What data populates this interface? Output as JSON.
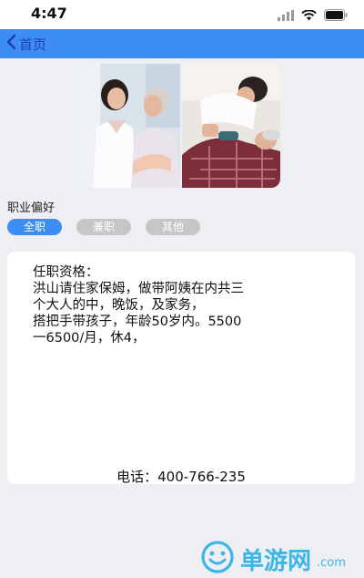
{
  "status_bar": {
    "time": "4:47",
    "icons": [
      "signal-icon",
      "wifi-icon",
      "battery-icon"
    ]
  },
  "nav": {
    "back_label": "首页",
    "background_color": "#3d8ef4"
  },
  "photos": [
    {
      "description": "caregiver-with-elderly-woman"
    },
    {
      "description": "caregiver-with-bedridden-patient"
    }
  ],
  "section": {
    "title": "职业偏好"
  },
  "filters": [
    {
      "label": "全职",
      "active": true
    },
    {
      "label": "兼职",
      "active": false
    },
    {
      "label": "其他",
      "active": false
    }
  ],
  "card": {
    "lines": [
      "任职资格：",
      "洪山请住家保姆，做带阿姨在内共三",
      "个大人的中，晚饭，及家务，",
      "搭把手带孩子，年龄50岁内。5500",
      "一6500/月，休4，"
    ],
    "phone_label": "电话：",
    "phone_number": "400-766-235"
  },
  "watermark": {
    "text": "单游网",
    "tld": ".com"
  }
}
